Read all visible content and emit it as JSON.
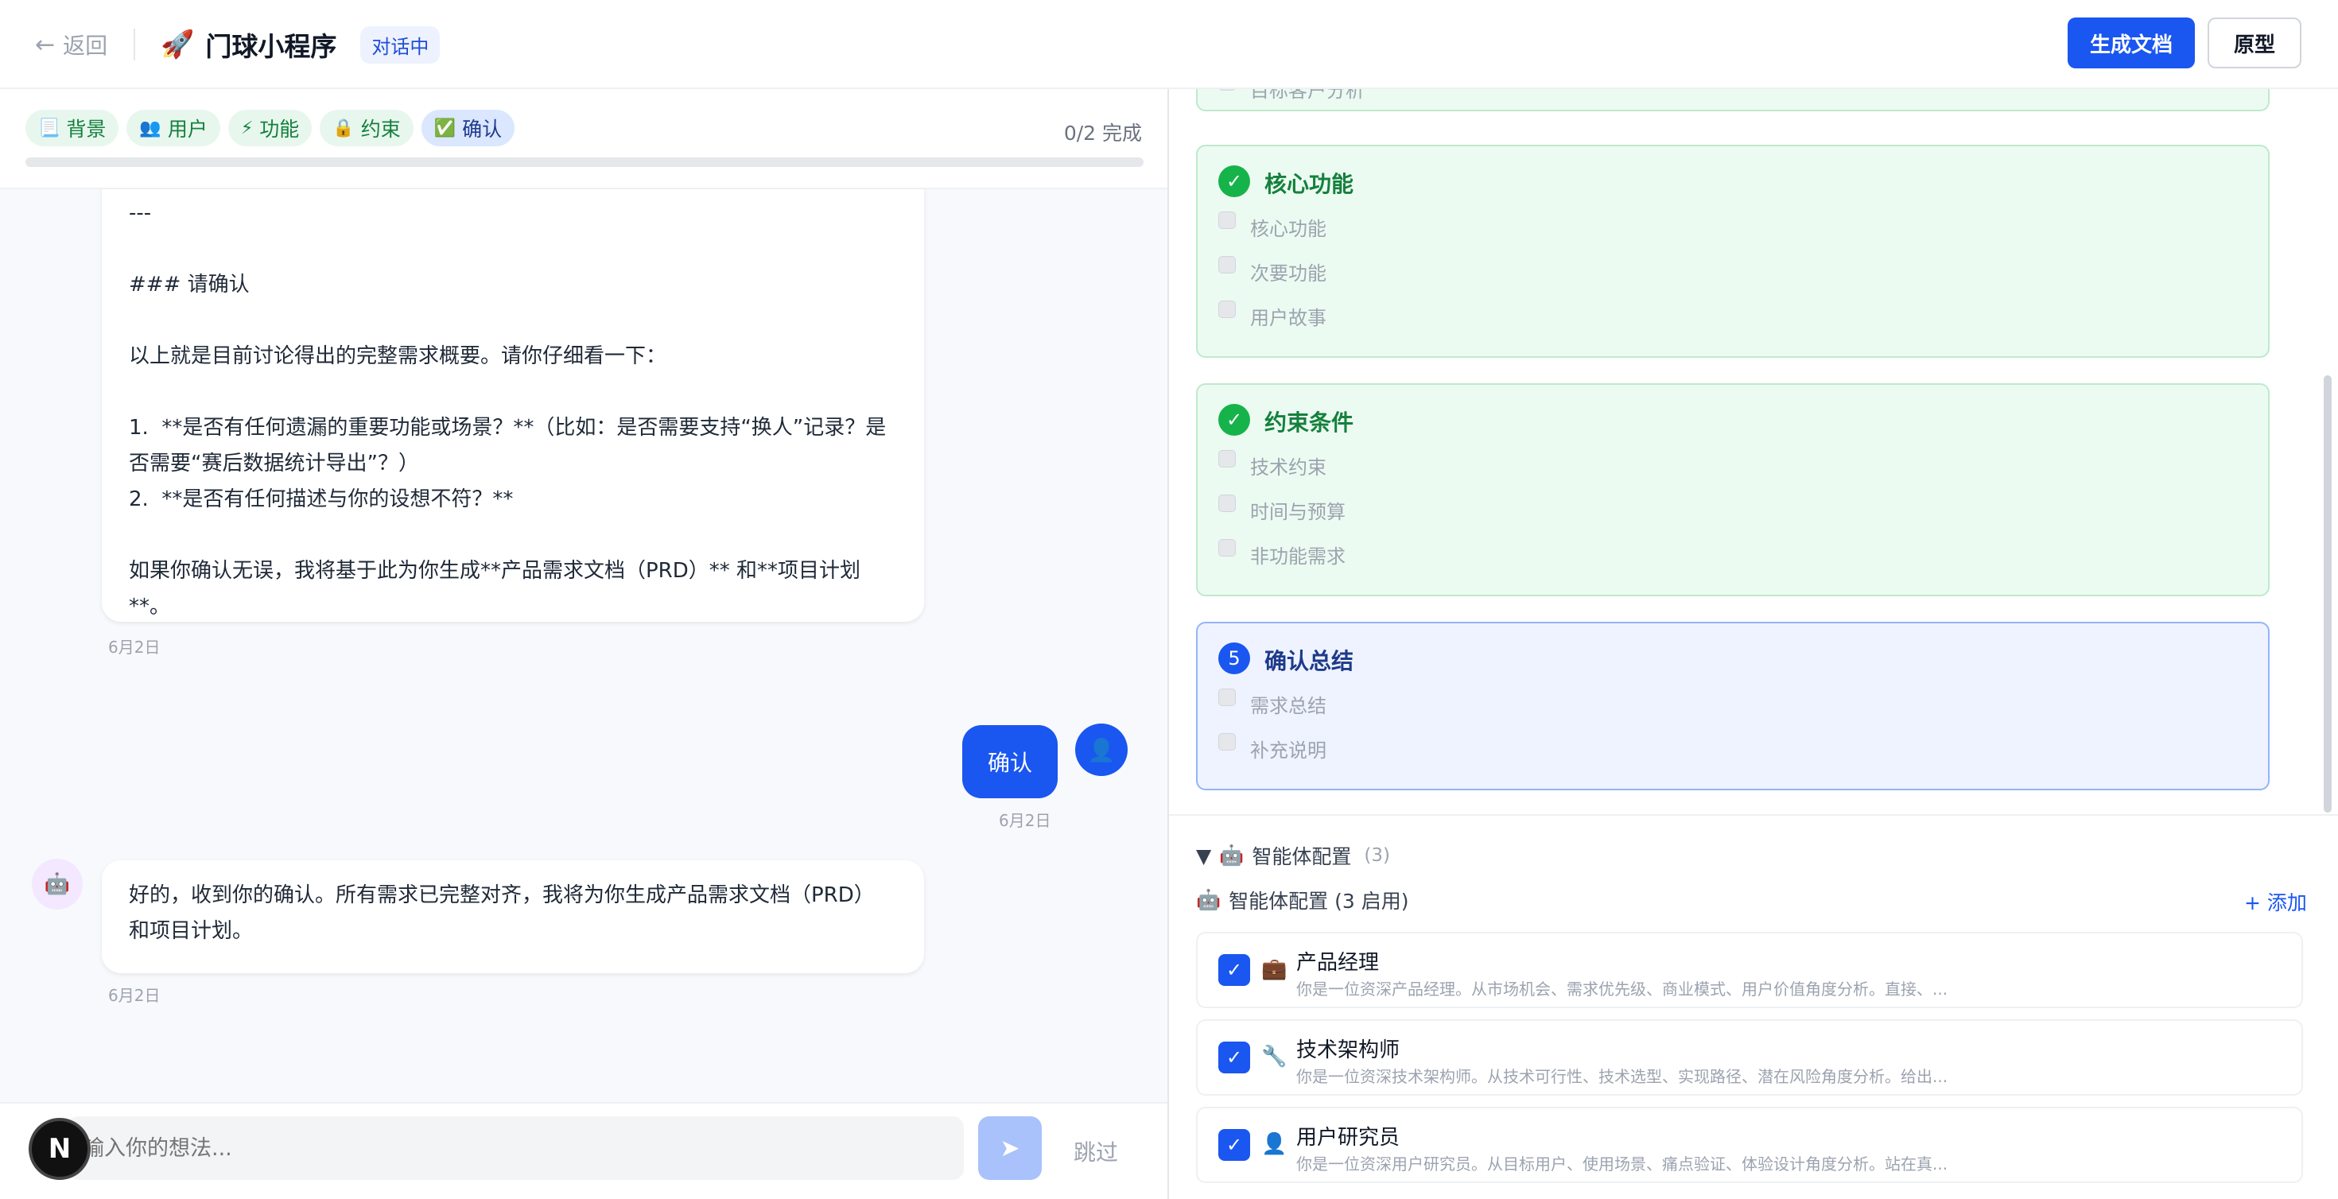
{
  "header": {
    "back_label": "返回",
    "project_icon": "rocket-icon",
    "project_name": "门球小程序",
    "status_badge": "对话中",
    "generate_doc_label": "生成文档",
    "prototype_label": "原型"
  },
  "stages": {
    "items": [
      {
        "icon": "📃",
        "label": "背景"
      },
      {
        "icon": "👥",
        "label": "用户"
      },
      {
        "icon": "⚡",
        "label": "功能"
      },
      {
        "icon": "🔒",
        "label": "约束"
      },
      {
        "icon": "✅",
        "label": "确认"
      }
    ],
    "progress_text": "0/2 完成"
  },
  "chat": {
    "messages": [
      {
        "role": "assistant",
        "text": "---\n\n### 请确认\n\n以上就是目前讨论得出的完整需求概要。请你仔细看一下：\n\n1.  **是否有任何遗漏的重要功能或场景？**（比如：是否需要支持“换人”记录？是否需要“赛后数据统计导出”？）\n2.  **是否有任何描述与你的设想不符？**\n\n如果你确认无误，我将基于此为你生成**产品需求文档（PRD）** 和**项目计划**。",
        "time": "6月2日"
      },
      {
        "role": "user",
        "text": "确认",
        "time": "6月2日"
      },
      {
        "role": "assistant",
        "text": "好的，收到你的确认。所有需求已完整对齐，我将为你生成产品需求文档（PRD）和项目计划。",
        "time": "6月2日"
      }
    ]
  },
  "composer": {
    "placeholder": "输入你的想法...",
    "skip_label": "跳过",
    "fab_letter": "N"
  },
  "steps": [
    {
      "state": "done",
      "title": "",
      "items": [
        "目标客户分析"
      ]
    },
    {
      "state": "done",
      "title": "核心功能",
      "items": [
        "核心功能",
        "次要功能",
        "用户故事"
      ]
    },
    {
      "state": "done",
      "title": "约束条件",
      "items": [
        "技术约束",
        "时间与预算",
        "非功能需求"
      ]
    },
    {
      "state": "current",
      "number": "5",
      "title": "确认总结",
      "items": [
        "需求总结",
        "补充说明"
      ]
    }
  ],
  "agents": {
    "toggle_label": "智能体配置",
    "toggle_count": "(3)",
    "header_label": "智能体配置 (3 启用)",
    "add_label": "+ 添加",
    "list": [
      {
        "icon": "💼",
        "name": "产品经理",
        "desc": "你是一位资深产品经理。从市场机会、需求优先级、商业模式、用户价值角度分析。直接、..."
      },
      {
        "icon": "🔧",
        "name": "技术架构师",
        "desc": "你是一位资深技术架构师。从技术可行性、技术选型、实现路径、潜在风险角度分析。给出..."
      },
      {
        "icon": "👤",
        "name": "用户研究员",
        "desc": "你是一位资深用户研究员。从目标用户、使用场景、痛点验证、体验设计角度分析。站在真..."
      }
    ]
  },
  "colors": {
    "primary": "#1a56f0",
    "done_green": "#16b34a",
    "done_bg": "#ecfbf1",
    "current_bg": "#eef3ff"
  }
}
